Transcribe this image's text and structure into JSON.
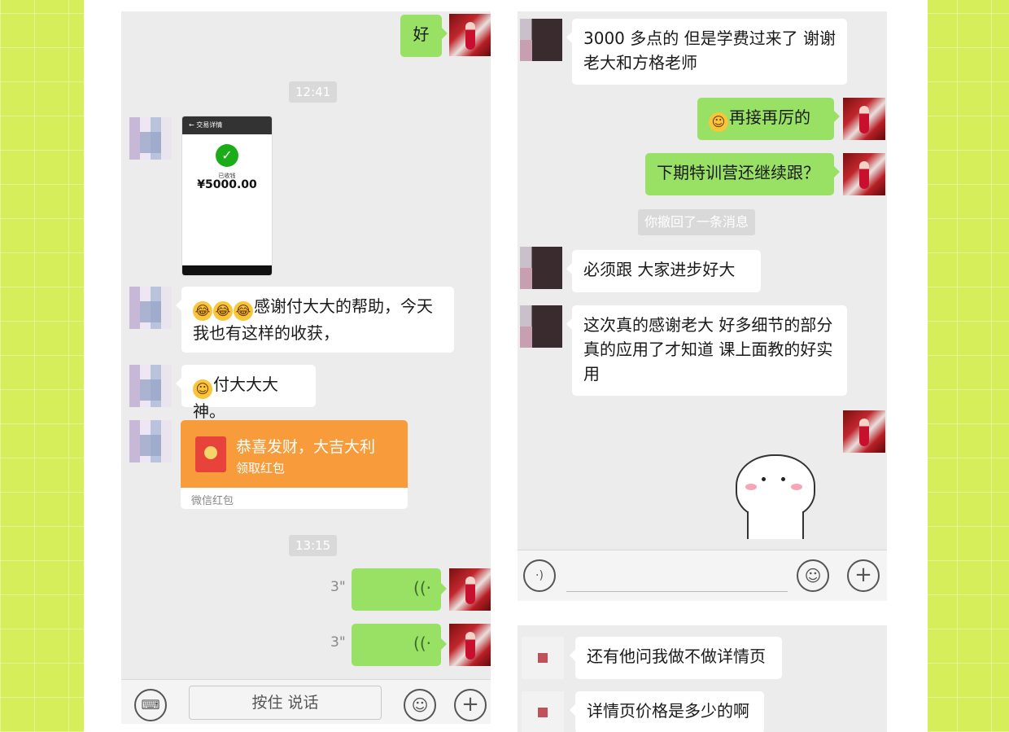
{
  "left_chat": {
    "first_message": "好",
    "time1": "12:41",
    "payment_screenshot": {
      "header": "交易详情",
      "status": "已收钱",
      "amount": "¥5000.00"
    },
    "message_thanks": "感谢付大大的帮助，今天我也有这样的收获，",
    "message_god": "付大大大神。",
    "red_packet": {
      "title": "恭喜发财，大吉大利",
      "action": "领取红包",
      "footer": "微信红包"
    },
    "time2": "13:15",
    "voice1_duration": "3\"",
    "voice2_duration": "3\"",
    "hold_to_talk": "按住 说话"
  },
  "right_chat": {
    "msg_tuition": "3000 多点的 但是学费过来了  谢谢老大和方格老师",
    "msg_keep_going": "再接再厉的",
    "msg_next_camp": "下期特训营还继续跟？",
    "recalled_notice": "你撤回了一条消息",
    "msg_must_follow": "必须跟 大家进步好大",
    "msg_thanks_details": "这次真的感谢老大  好多细节的部分真的应用了才知道 课上面教的好实用"
  },
  "bottom_chat": {
    "msg_detail_page": "还有他问我做不做详情页",
    "msg_price": "详情页价格是多少的啊"
  },
  "colors": {
    "background": "#d6ee5a",
    "chat_bg": "#ececec",
    "bubble_green": "#98e165",
    "red_packet": "#f89c3b"
  }
}
